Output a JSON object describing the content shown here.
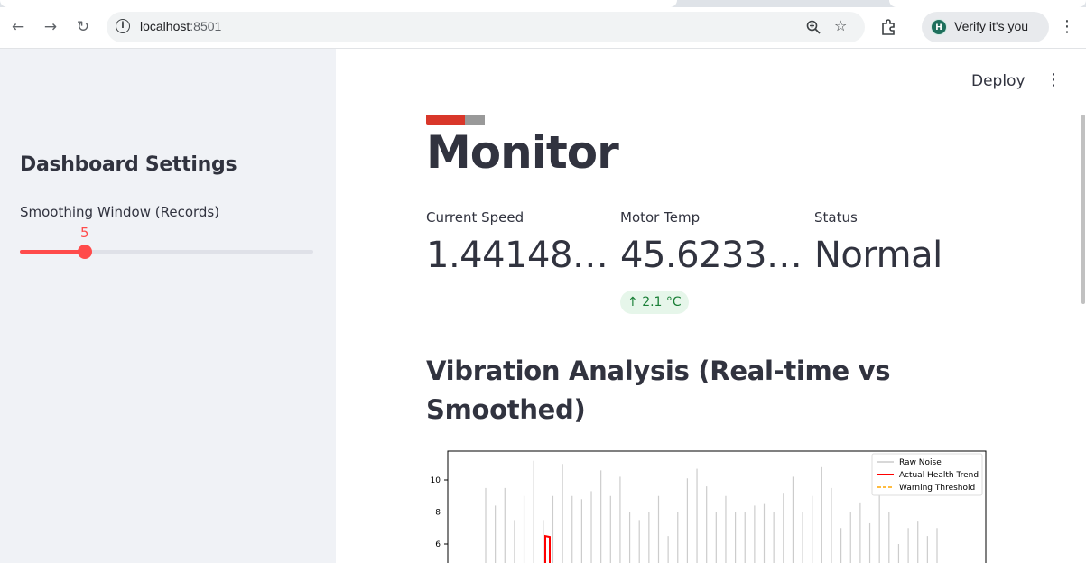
{
  "browser": {
    "url_host": "localhost",
    "url_port": ":8501",
    "profile_label": "Verify it's you",
    "profile_initial": "H"
  },
  "header": {
    "deploy_label": "Deploy"
  },
  "sidebar": {
    "title": "Dashboard Settings",
    "slider": {
      "label": "Smoothing Window (Records)",
      "value": "5",
      "fraction": 0.22
    }
  },
  "main": {
    "title": "Monitor",
    "metrics": [
      {
        "label": "Current Speed",
        "value": "1.44148…"
      },
      {
        "label": "Motor Temp",
        "value": "45.6233…",
        "delta": "2.1 °C"
      },
      {
        "label": "Status",
        "value": "Normal"
      }
    ],
    "section_title": "Vibration Analysis (Real-time vs Smoothed)"
  },
  "colors": {
    "accent": "#ff4b4b",
    "delta_bg": "#e6f6ea",
    "delta_text": "#1a7f37",
    "raw_noise": "#cccccc",
    "trend": "#ff0000",
    "threshold": "#ffa500"
  },
  "chart_data": {
    "type": "line",
    "y_ticks": [
      "10",
      "8",
      "6"
    ],
    "legend": [
      "Raw Noise",
      "Actual Health Trend",
      "Warning Threshold"
    ],
    "legend_position": "top-right",
    "series": [
      {
        "name": "Raw Noise",
        "style": "solid",
        "color": "#cccccc"
      },
      {
        "name": "Actual Health Trend",
        "style": "solid",
        "color": "#ff0000"
      },
      {
        "name": "Warning Threshold",
        "style": "dashed",
        "color": "#ffa500"
      }
    ],
    "raw_spikes": [
      9.5,
      8.4,
      9.5,
      7.5,
      9.0,
      11.2,
      7.5,
      9.0,
      11.0,
      9.0,
      8.8,
      9.3,
      10.6,
      9.0,
      10.2,
      8.0,
      7.5,
      8.0,
      9.0,
      6.5,
      8.0,
      10.1,
      10.7,
      9.6,
      8.0,
      9.0,
      8.0,
      8.0,
      8.4,
      8.5,
      8.0,
      9.2,
      10.2,
      8.0,
      9.0,
      10.8,
      9.5,
      7.0,
      8.0,
      8.6,
      7.3,
      9.5,
      8.0,
      6.0,
      7.0,
      7.4,
      6.5,
      7.0
    ],
    "trend_peak": 6.5
  }
}
